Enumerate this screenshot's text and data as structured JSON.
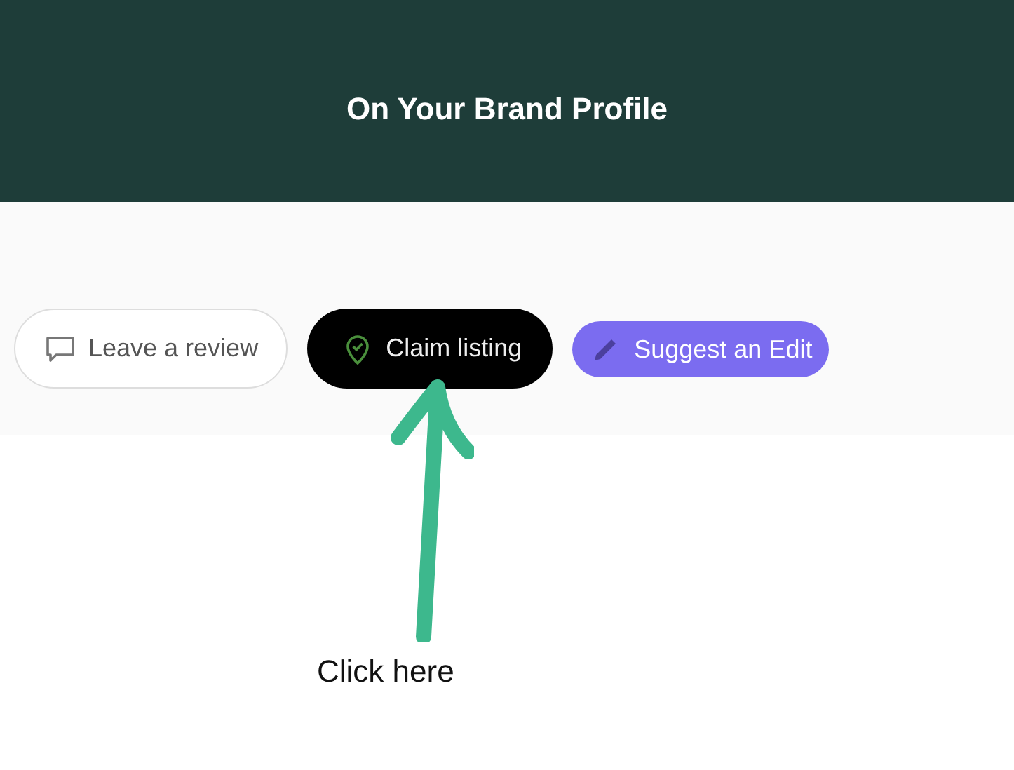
{
  "header": {
    "title": "On Your Brand Profile"
  },
  "actions": [
    {
      "kind": "review",
      "label": "Leave a review"
    },
    {
      "kind": "claim",
      "label": "Claim listing"
    },
    {
      "kind": "edit",
      "label": "Suggest an Edit"
    }
  ],
  "annotation": {
    "text": "Click here"
  }
}
